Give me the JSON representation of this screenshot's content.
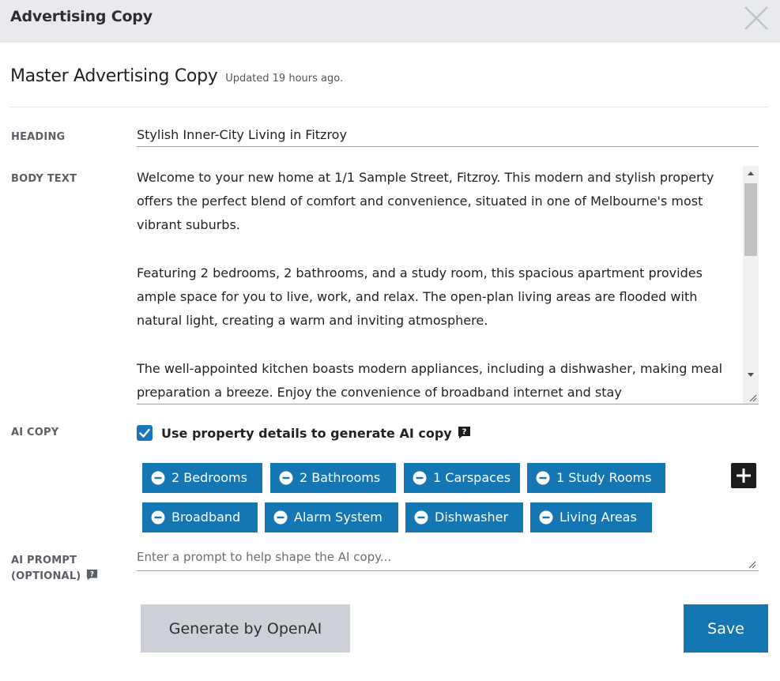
{
  "dialog": {
    "title": "Advertising Copy",
    "close_icon": "close-icon"
  },
  "master": {
    "title": "Master Advertising Copy",
    "updated": "Updated 19 hours ago."
  },
  "form": {
    "heading_label": "HEADING",
    "heading_value": "Stylish Inner-City Living in Fitzroy",
    "body_label": "BODY TEXT",
    "body_paragraphs": [
      "Welcome to your new home at 1/1 Sample Street, Fitzroy. This modern and stylish property offers the perfect blend of comfort and convenience, situated in one of Melbourne's most vibrant suburbs.",
      "Featuring 2 bedrooms, 2 bathrooms, and a study room, this spacious apartment provides ample space for you to live, work, and relax. The open-plan living areas are flooded with natural light, creating a warm and inviting atmosphere.",
      "The well-appointed kitchen boasts modern appliances, including a dishwasher, making meal preparation a breeze. Enjoy the convenience of broadband internet and stay"
    ],
    "ai_copy_label": "AI COPY",
    "ai_copy_checkbox_label": "Use property details to generate AI copy",
    "ai_copy_checked": true,
    "features": [
      "2 Bedrooms",
      "2 Bathrooms",
      "1 Carspaces",
      "1 Study Rooms",
      "Broadband",
      "Alarm System",
      "Dishwasher",
      "Living Areas"
    ],
    "ai_prompt_label_line1": "AI PROMPT",
    "ai_prompt_label_line2": "(OPTIONAL)",
    "ai_prompt_placeholder": "Enter a prompt to help shape the AI copy...",
    "ai_prompt_value": ""
  },
  "actions": {
    "generate_label": "Generate by OpenAI",
    "save_label": "Save"
  },
  "colors": {
    "accent": "#1576b4",
    "titlebar": "#e8eaee",
    "secondary_button": "#cdd0d6"
  }
}
